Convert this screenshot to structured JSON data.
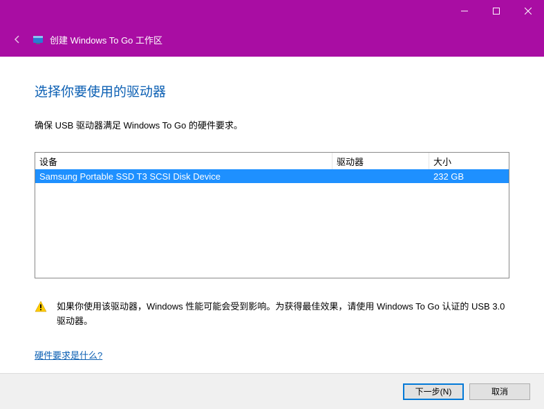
{
  "header": {
    "title": "创建 Windows To Go 工作区"
  },
  "page": {
    "title": "选择你要使用的驱动器",
    "instruction": "确保 USB 驱动器满足 Windows To Go 的硬件要求。"
  },
  "grid": {
    "columns": {
      "device": "设备",
      "drive": "驱动器",
      "size": "大小"
    },
    "rows": [
      {
        "device": "Samsung Portable SSD T3 SCSI Disk Device",
        "drive": "",
        "size": "232 GB"
      }
    ]
  },
  "warning": {
    "text": "如果你使用该驱动器，Windows 性能可能会受到影响。为获得最佳效果，请使用 Windows To Go 认证的 USB 3.0 驱动器。"
  },
  "link": {
    "label": "硬件要求是什么?"
  },
  "footer": {
    "next": "下一步(N)",
    "cancel": "取消"
  }
}
